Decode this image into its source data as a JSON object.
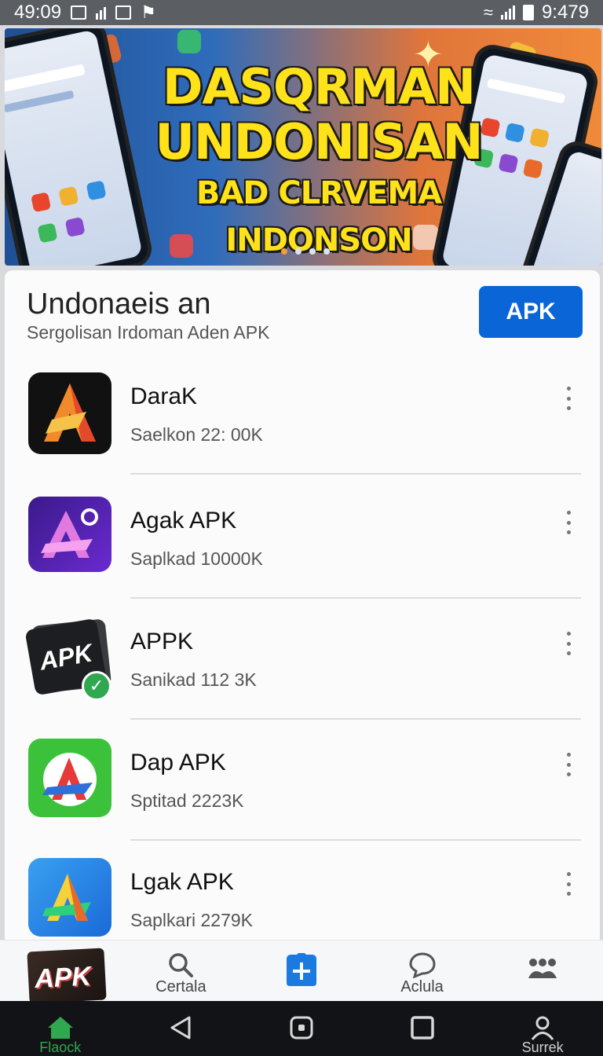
{
  "statusbar": {
    "time_left": "49:09",
    "time_right": "9:479"
  },
  "banner": {
    "line1": "DASQRMAN",
    "line2": "UNDONISAN",
    "line3": "BAD CLRVEMA INDONSON",
    "active_dot": 0,
    "dot_count": 4
  },
  "header": {
    "title": "Undonaeis an",
    "subtitle": "Sergolisan Irdoman  Aden  APK",
    "apk_button": "APK"
  },
  "apps": [
    {
      "name": "DaraK",
      "meta": "Saelkon 22: 00K",
      "icon": "dark-a-icon"
    },
    {
      "name": "Agak APK",
      "meta": "Saplkad 10000K",
      "icon": "purple-a-icon"
    },
    {
      "name": "APPK",
      "meta": "Sanikad 112 3K",
      "icon": "apk-card-icon"
    },
    {
      "name": "Dap APK",
      "meta": "Sptitad 2223K",
      "icon": "green-a-icon"
    },
    {
      "name": "Lgak APK",
      "meta": "Saplkari 2279K",
      "icon": "blue-a-icon"
    }
  ],
  "tabs": [
    {
      "label": "",
      "icon": "apk-tile-icon"
    },
    {
      "label": "Certala",
      "icon": "search-icon"
    },
    {
      "label": "",
      "icon": "add-icon"
    },
    {
      "label": "Aclula",
      "icon": "chat-icon"
    },
    {
      "label": "",
      "icon": "people-icon"
    }
  ],
  "navbar": [
    {
      "label": "Flaock",
      "icon": "home-icon"
    },
    {
      "label": "",
      "icon": "back-icon"
    },
    {
      "label": "",
      "icon": "home-circle-icon"
    },
    {
      "label": "",
      "icon": "recents-icon"
    },
    {
      "label": "Surrek",
      "icon": "profile-icon"
    }
  ],
  "colors": {
    "accent": "#0a66d6",
    "banner_text": "#ffe21a",
    "nav_active": "#2fa84f"
  }
}
